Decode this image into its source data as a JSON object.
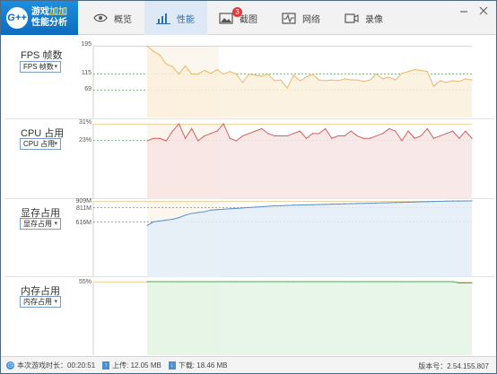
{
  "app": {
    "logo_badge": "G++",
    "logo_line1_a": "游戏",
    "logo_line1_b": "加加",
    "logo_line2": "性能分析"
  },
  "tabs": [
    {
      "label": "概览",
      "icon": "eye-icon"
    },
    {
      "label": "性能",
      "icon": "bar-chart-icon",
      "active": true
    },
    {
      "label": "截图",
      "icon": "image-icon",
      "badge": "3"
    },
    {
      "label": "网络",
      "icon": "pulse-icon"
    },
    {
      "label": "录像",
      "icon": "video-icon"
    }
  ],
  "panels": {
    "fps": {
      "label": "FPS 帧数",
      "dropdown": "FPS 帧数",
      "yticks": [
        "195",
        "115",
        "69"
      ]
    },
    "cpu": {
      "label": "CPU 占用",
      "dropdown": "CPU 占用",
      "yticks": [
        "31%",
        "23%"
      ]
    },
    "vram": {
      "label": "显存占用",
      "dropdown": "显存占用",
      "yticks": [
        "909M",
        "811M",
        "616M"
      ]
    },
    "ram": {
      "label": "内存占用",
      "dropdown": "内存占用",
      "yticks": [
        "55%"
      ]
    }
  },
  "chart_data": [
    {
      "type": "line",
      "title": "FPS 帧数",
      "ylim": [
        0,
        195
      ],
      "reference_lines": [
        195,
        115,
        69
      ],
      "color": "#e8b86a",
      "fill": "#fbf0dc",
      "values": [
        195,
        180,
        170,
        145,
        138,
        118,
        140,
        118,
        118,
        128,
        120,
        130,
        118,
        125,
        118,
        95,
        118,
        115,
        112,
        118,
        100,
        102,
        80,
        115,
        100,
        110,
        118,
        102,
        100,
        102,
        100,
        105,
        102,
        102,
        98,
        102,
        118,
        105,
        110,
        102,
        120,
        125,
        130,
        128,
        125,
        85,
        100,
        95,
        100,
        98,
        105,
        102
      ]
    },
    {
      "type": "line",
      "title": "CPU 占用",
      "ylim": [
        0,
        31
      ],
      "reference_lines": [
        31,
        23
      ],
      "color": "#d06060",
      "fill": "#f8e4e4",
      "values": [
        24,
        25,
        25,
        24,
        28,
        31,
        25,
        29,
        24,
        26,
        27,
        28,
        31,
        25,
        24,
        26,
        27,
        28,
        29,
        27,
        26,
        26,
        26,
        27,
        28,
        25,
        27,
        27,
        29,
        25,
        26,
        26,
        28,
        26,
        25,
        25,
        26,
        27,
        29,
        28,
        24,
        28,
        25,
        26,
        29,
        25,
        26,
        27,
        28,
        25,
        28,
        25
      ]
    },
    {
      "type": "line",
      "title": "显存占用",
      "ylim": [
        0,
        909
      ],
      "reference_lines": [
        909,
        811,
        616
      ],
      "color": "#5b8ec8",
      "fill": "#e3edf8",
      "values": [
        616,
        660,
        670,
        680,
        690,
        710,
        740,
        760,
        770,
        780,
        800,
        805,
        810,
        815,
        820,
        825,
        830,
        835,
        840,
        845,
        850,
        852,
        855,
        858,
        860,
        862,
        864,
        866,
        868,
        870,
        872,
        874,
        876,
        878,
        880,
        882,
        884,
        886,
        888,
        890,
        892,
        894,
        896,
        898,
        900,
        902,
        904,
        906,
        907,
        908,
        909,
        909
      ]
    },
    {
      "type": "line",
      "title": "内存占用",
      "ylim": [
        0,
        55
      ],
      "reference_lines": [
        55
      ],
      "color": "#4fae5c",
      "fill": "#e3f4e4",
      "values": [
        56,
        56,
        56,
        55,
        55,
        55,
        55,
        55,
        55,
        55,
        55,
        55,
        55,
        55,
        55,
        55,
        55,
        55,
        55,
        55,
        55,
        55,
        55,
        55,
        55,
        55,
        55,
        55,
        55,
        55,
        55,
        55,
        55,
        55,
        55,
        55,
        55,
        55,
        55,
        55,
        55,
        55,
        55,
        55,
        55,
        55,
        55,
        55,
        55,
        54,
        54,
        54
      ]
    }
  ],
  "status": {
    "session_label": "本次游戏时长：00:20:51",
    "upload_label": "上传: 12.05 MB",
    "download_label": "下载: 18.46 MB",
    "version_label": "版本号：2.54.155.807"
  },
  "colors": {
    "accent": "#2a6fb5",
    "highlight_bg": "#f7efe0"
  }
}
